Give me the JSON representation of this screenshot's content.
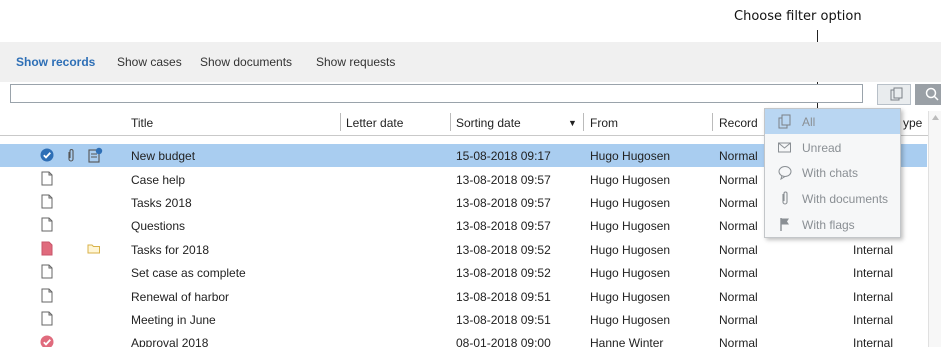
{
  "callout": {
    "text": "Choose filter option"
  },
  "tabs": [
    {
      "label": "Show records",
      "active": true
    },
    {
      "label": "Show cases"
    },
    {
      "label": "Show documents"
    },
    {
      "label": "Show requests"
    }
  ],
  "search": {
    "value": "",
    "placeholder": ""
  },
  "columns": {
    "title": "Title",
    "letter_date": "Letter date",
    "sorting_date": "Sorting date",
    "from": "From",
    "record": "Record",
    "type": "ype"
  },
  "rows": [
    {
      "title": "New budget",
      "sorting_date": "15-08-2018 09:17",
      "from": "Hugo Hugosen",
      "record": "Normal",
      "type": "",
      "icon": "check-circle-icon",
      "selected": true
    },
    {
      "title": "Case help",
      "sorting_date": "13-08-2018 09:57",
      "from": "Hugo Hugosen",
      "record": "Normal",
      "type": "",
      "icon": "document-icon"
    },
    {
      "title": "Tasks 2018",
      "sorting_date": "13-08-2018 09:57",
      "from": "Hugo Hugosen",
      "record": "Normal",
      "type": "",
      "icon": "document-icon"
    },
    {
      "title": "Questions",
      "sorting_date": "13-08-2018 09:57",
      "from": "Hugo Hugosen",
      "record": "Normal",
      "type": "",
      "icon": "document-icon"
    },
    {
      "title": "Tasks for 2018",
      "sorting_date": "13-08-2018 09:52",
      "from": "Hugo Hugosen",
      "record": "Normal",
      "type": "Internal",
      "icon": "red-document-icon"
    },
    {
      "title": "Set case as complete",
      "sorting_date": "13-08-2018 09:52",
      "from": "Hugo Hugosen",
      "record": "Normal",
      "type": "Internal",
      "icon": "document-icon"
    },
    {
      "title": "Renewal of harbor",
      "sorting_date": "13-08-2018 09:51",
      "from": "Hugo Hugosen",
      "record": "Normal",
      "type": "Internal",
      "icon": "document-icon"
    },
    {
      "title": "Meeting in June",
      "sorting_date": "13-08-2018 09:51",
      "from": "Hugo Hugosen",
      "record": "Normal",
      "type": "Internal",
      "icon": "document-icon"
    },
    {
      "title": "Approval 2018",
      "sorting_date": "08-01-2018 09:00",
      "from": "Hanne Winter",
      "record": "Normal",
      "type": "Internal",
      "icon": "red-check-circle-icon"
    }
  ],
  "filter_menu": [
    {
      "label": "All",
      "icon": "copy-icon",
      "selected": true
    },
    {
      "label": "Unread",
      "icon": "envelope-icon"
    },
    {
      "label": "With chats",
      "icon": "chat-bubble-icon"
    },
    {
      "label": "With documents",
      "icon": "paperclip-icon"
    },
    {
      "label": "With flags",
      "icon": "flag-icon"
    }
  ],
  "colors": {
    "accent": "#2e6fb6",
    "selected_row": "#a9cdf0",
    "menu_selected": "#b9d6f2"
  }
}
